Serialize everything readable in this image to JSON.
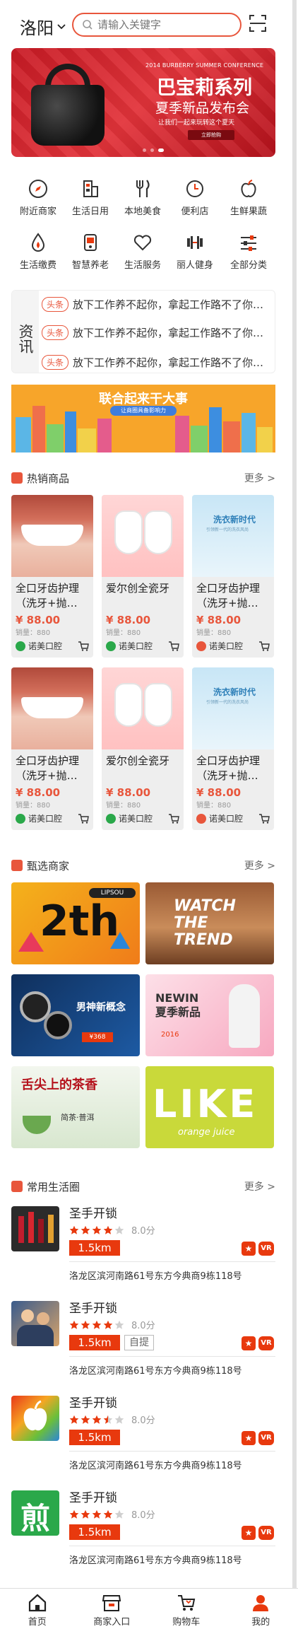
{
  "header": {
    "city": "洛阳",
    "search_placeholder": "请输入关键字"
  },
  "banner": {
    "conference": "2014 BURBERRY SUMMER CONFERENCE",
    "title": "巴宝莉系列",
    "subtitle": "夏季新品发布会",
    "tagline": "让我们一起来玩转这个夏天",
    "button": "立即抢购"
  },
  "categories": [
    {
      "label": "附近商家",
      "icon": "compass-icon"
    },
    {
      "label": "生活日用",
      "icon": "building-icon"
    },
    {
      "label": "本地美食",
      "icon": "cutlery-icon"
    },
    {
      "label": "便利店",
      "icon": "clock-icon"
    },
    {
      "label": "生鲜果蔬",
      "icon": "apple-icon"
    },
    {
      "label": "生活缴费",
      "icon": "drop-icon"
    },
    {
      "label": "智慧养老",
      "icon": "device-icon"
    },
    {
      "label": "生活服务",
      "icon": "heart-icon"
    },
    {
      "label": "丽人健身",
      "icon": "dumbbell-icon"
    },
    {
      "label": "全部分类",
      "icon": "sliders-icon"
    }
  ],
  "news": {
    "tag": "资讯",
    "items": [
      {
        "pill": "头条",
        "text": "放下工作养不起你，拿起工作路不了你…"
      },
      {
        "pill": "头条",
        "text": "放下工作养不起你，拿起工作路不了你…"
      },
      {
        "pill": "头条",
        "text": "放下工作养不起你，拿起工作路不了你…"
      }
    ]
  },
  "promo": {
    "title": "联合起来干大事",
    "subtitle": "让商圈具备影响力"
  },
  "hot": {
    "title": "热销商品",
    "more": "更多 >",
    "products": [
      {
        "name": "全口牙齿护理（洗牙+抛…",
        "price": "¥ 88.00",
        "sales": "销量：880",
        "shop": "诺美口腔",
        "img": "teeth",
        "shop_color": "#2aa84a"
      },
      {
        "name": "爱尔创全瓷牙",
        "price": "¥ 88.00",
        "sales": "销量：880",
        "shop": "诺美口腔",
        "img": "cartoon",
        "shop_color": "#2aa84a"
      },
      {
        "name": "全口牙齿护理（洗牙+抛…",
        "price": "¥ 88.00",
        "sales": "销量：880",
        "shop": "诺美口腔",
        "img": "wash",
        "shop_color": "#e8563c"
      },
      {
        "name": "全口牙齿护理（洗牙+抛…",
        "price": "¥ 88.00",
        "sales": "销量：880",
        "shop": "诺美口腔",
        "img": "teeth",
        "shop_color": "#2aa84a"
      },
      {
        "name": "爱尔创全瓷牙",
        "price": "¥ 88.00",
        "sales": "销量：880",
        "shop": "诺美口腔",
        "img": "cartoon",
        "shop_color": "#2aa84a"
      },
      {
        "name": "全口牙齿护理（洗牙+抛…",
        "price": "¥ 88.00",
        "sales": "销量：880",
        "shop": "诺美口腔",
        "img": "wash",
        "shop_color": "#e8563c"
      }
    ],
    "wash_title": "洗衣新时代",
    "wash_sub": "引领新一代的洗衣风尚"
  },
  "merchants": {
    "title": "甄选商家",
    "more": "更多 >",
    "tiles": [
      {
        "text": "2th",
        "brand": "LIPSOU"
      },
      {
        "text": "WATCH THE TREND",
        "brand": ""
      },
      {
        "text": "男神新概念",
        "brand": "¥368"
      },
      {
        "text": "NEWIN 夏季新品",
        "brand": "2016"
      },
      {
        "text": "舌尖上的茶香",
        "brand": "简茶·普洱"
      },
      {
        "text": "LIKE",
        "brand": "orange juice"
      }
    ]
  },
  "life": {
    "title": "常用生活圈",
    "more": "更多 >",
    "items": [
      {
        "name": "圣手开锁",
        "score": "8.0分",
        "dist": "1.5km",
        "self": "",
        "addr": "洛龙区滨河南路61号东方今典商9栋118号",
        "thumb": "lipstick"
      },
      {
        "name": "圣手开锁",
        "score": "8.0分",
        "dist": "1.5km",
        "self": "自提",
        "addr": "洛龙区滨河南路61号东方今典商9栋118号",
        "thumb": "people"
      },
      {
        "name": "圣手开锁",
        "score": "8.0分",
        "dist": "1.5km",
        "self": "",
        "addr": "洛龙区滨河南路61号东方今典商9栋118号",
        "thumb": "apple"
      },
      {
        "name": "圣手开锁",
        "score": "8.0分",
        "dist": "1.5km",
        "self": "",
        "addr": "洛龙区滨河南路61号东方今典商9栋118号",
        "thumb": "green"
      }
    ],
    "badge_star": "★",
    "badge_vr": "VR"
  },
  "tabs": [
    {
      "label": "首页",
      "icon": "home-icon"
    },
    {
      "label": "商家入口",
      "icon": "store-icon"
    },
    {
      "label": "购物车",
      "icon": "cart-icon"
    },
    {
      "label": "我的",
      "icon": "user-icon"
    }
  ],
  "colors": {
    "accent": "#e8563c",
    "tab_active": "#e8390e"
  }
}
